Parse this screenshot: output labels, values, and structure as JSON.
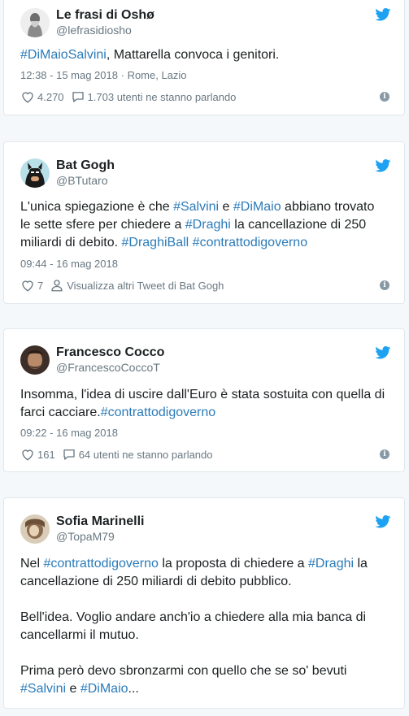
{
  "icons": {
    "bird": "twitter-bird-icon",
    "heart": "heart-icon",
    "comment": "comment-icon",
    "person": "person-icon",
    "info": "info-icon"
  },
  "colors": {
    "link": "#2b7bb9",
    "bird": "#1da1f2",
    "muted": "#697882"
  },
  "tweets": [
    {
      "name": "Le frasi di Oshø",
      "handle": "@lefrasidiosho",
      "text": [
        {
          "t": "#DiMaioSalvini",
          "tag": true
        },
        {
          "t": ", Mattarella convoca i genitori.",
          "tag": false
        }
      ],
      "timestamp": "12:38 - 15 mag 2018",
      "location": "Rome, Lazio",
      "likes": "4.270",
      "action2": "1.703 utenti ne stanno parlando"
    },
    {
      "name": "Bat Gogh",
      "handle": "@BTutaro",
      "text": [
        {
          "t": "L'unica spiegazione è che ",
          "tag": false
        },
        {
          "t": "#Salvini",
          "tag": true
        },
        {
          "t": " e ",
          "tag": false
        },
        {
          "t": "#DiMaio",
          "tag": true
        },
        {
          "t": " abbiano trovato le sette sfere per chiedere a ",
          "tag": false
        },
        {
          "t": "#Draghi",
          "tag": true
        },
        {
          "t": " la cancellazione di 250 miliardi di debito. ",
          "tag": false
        },
        {
          "t": "#DraghiBall",
          "tag": true
        },
        {
          "t": " ",
          "tag": false
        },
        {
          "t": "#contrattodigoverno",
          "tag": true
        }
      ],
      "timestamp": "09:44 - 16 mag 2018",
      "likes": "7",
      "action2": "Visualizza altri Tweet di Bat Gogh"
    },
    {
      "name": "Francesco Cocco",
      "handle": "@FrancescoCoccoT",
      "text": [
        {
          "t": "Insomma, l'idea di uscire dall'Euro è stata sostuita con quella di farci cacciare.",
          "tag": false
        },
        {
          "t": "#contrattodigoverno",
          "tag": true
        }
      ],
      "timestamp": "09:22 - 16 mag 2018",
      "likes": "161",
      "action2": "64 utenti ne stanno parlando"
    },
    {
      "name": "Sofia Marinelli",
      "handle": "@TopaM79",
      "paragraphs": [
        [
          {
            "t": "Nel ",
            "tag": false
          },
          {
            "t": "#contrattodigoverno",
            "tag": true
          },
          {
            "t": " la proposta di chiedere a ",
            "tag": false
          },
          {
            "t": "#Draghi",
            "tag": true
          },
          {
            "t": " la cancellazione di 250 miliardi di debito pubblico.",
            "tag": false
          }
        ],
        [
          {
            "t": "Bell'idea. Voglio andare anch'io a chiedere alla mia banca di cancellarmi il mutuo.",
            "tag": false
          }
        ],
        [
          {
            "t": "Prima però devo sbronzarmi con quello che se so' bevuti ",
            "tag": false
          },
          {
            "t": "#Salvini",
            "tag": true
          },
          {
            "t": " e ",
            "tag": false
          },
          {
            "t": "#DiMaio",
            "tag": true
          },
          {
            "t": "...",
            "tag": false
          }
        ]
      ]
    }
  ]
}
